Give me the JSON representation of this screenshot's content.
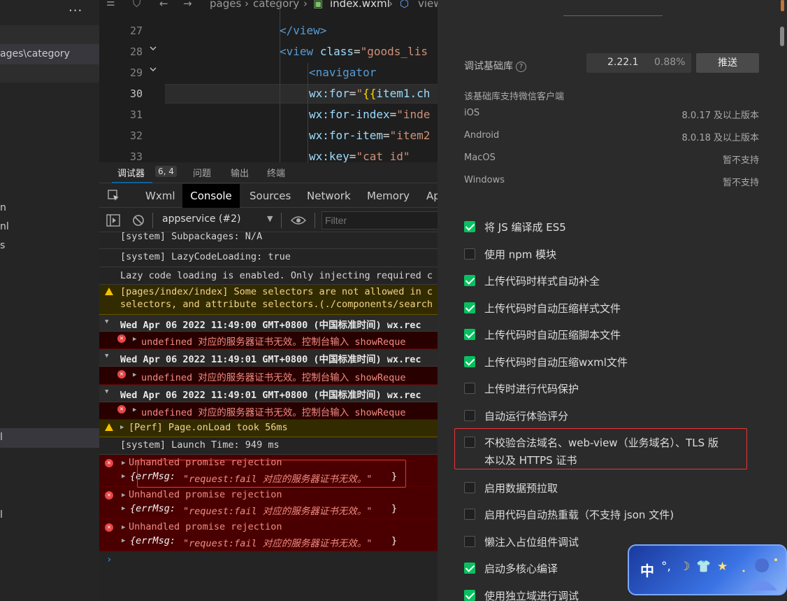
{
  "sidebar": {
    "menu": "...",
    "path_fragment": "ages\\category",
    "frag_n": "n",
    "frag_nl": "nl",
    "frag_s": "s",
    "frag_l": "l",
    "frag_l2": "l"
  },
  "breadcrumb": {
    "items": [
      "pages",
      "category",
      "index.wxml",
      "view"
    ]
  },
  "editor": {
    "lines": [
      {
        "num": "27",
        "html": "</view>"
      },
      {
        "num": "28",
        "html": "<view class=\"goods_lis"
      },
      {
        "num": "29",
        "html": "<navigator"
      },
      {
        "num": "30",
        "html": "wx:for=\"{{item1.ch"
      },
      {
        "num": "31",
        "html": "wx:for-index=\"inde"
      },
      {
        "num": "32",
        "html": "wx:for-item=\"item2"
      },
      {
        "num": "33",
        "html": "wx:key=\"cat_id\""
      }
    ]
  },
  "debug_tabs": {
    "debugger": "调试器",
    "position": "6, 4",
    "issues": "问题",
    "output": "输出",
    "terminal": "终端"
  },
  "devtools_tabs": [
    "Wxml",
    "Console",
    "Sources",
    "Network",
    "Memory",
    "Ap"
  ],
  "console_toolbar": {
    "context": "appservice (#2)",
    "filter_placeholder": "Filter"
  },
  "console": [
    {
      "type": "sys",
      "text": "[system] Subpackages: N/A"
    },
    {
      "type": "sys",
      "text": "[system] LazyCodeLoading: true"
    },
    {
      "type": "sys",
      "text": "Lazy code loading is enabled. Only injecting required c"
    },
    {
      "type": "warn",
      "text1": "[pages/index/index] Some selectors are not allowed in c",
      "text2": "selectors, and attribute selectors.(./components/search"
    },
    {
      "type": "grp",
      "text": "Wed Apr 06 2022 11:49:00 GMT+0800 (中国标准时间) wx.rec"
    },
    {
      "type": "err",
      "text": "undefined 对应的服务器证书无效。控制台输入 showReque"
    },
    {
      "type": "grp",
      "text": "Wed Apr 06 2022 11:49:01 GMT+0800 (中国标准时间) wx.rec"
    },
    {
      "type": "err",
      "text": "undefined 对应的服务器证书无效。控制台输入 showReque"
    },
    {
      "type": "grp",
      "text": "Wed Apr 06 2022 11:49:01 GMT+0800 (中国标准时间) wx.rec"
    },
    {
      "type": "err",
      "text": "undefined 对应的服务器证书无效。控制台输入 showReque"
    },
    {
      "type": "warn1",
      "text": "[Perf] Page.onLoad took 56ms"
    },
    {
      "type": "sys",
      "text": "[system] Launch Time: 949 ms"
    },
    {
      "type": "errbig",
      "text1": "Unhandled promise rejection",
      "key": "{errMsg: ",
      "val": "\"request:fail 对应的服务器证书无效。\"",
      "close": "}"
    },
    {
      "type": "errbig",
      "text1": "Unhandled promise rejection",
      "key": "{errMsg: ",
      "val": "\"request:fail 对应的服务器证书无效。\"",
      "close": "}"
    },
    {
      "type": "errbig",
      "text1": "Unhandled promise rejection",
      "key": "{errMsg: ",
      "val": "\"request:fail 对应的服务器证书无效。\"",
      "close": "}"
    }
  ],
  "console_prompt": "›",
  "settings": {
    "base_lib_label": "调试基础库",
    "help": "?",
    "version": "2.22.1",
    "percent": "0.88%",
    "push": "推送",
    "support_title": "该基础库支持微信客户端",
    "platforms": [
      {
        "name": "iOS",
        "value": "8.0.17 及以上版本"
      },
      {
        "name": "Android",
        "value": "8.0.18 及以上版本"
      },
      {
        "name": "MacOS",
        "value": "暂不支持"
      },
      {
        "name": "Windows",
        "value": "暂不支持"
      }
    ],
    "options": [
      {
        "label": "将 JS 编译成 ES5",
        "checked": true
      },
      {
        "label": "使用 npm 模块",
        "checked": false
      },
      {
        "label": "上传代码时样式自动补全",
        "checked": true
      },
      {
        "label": "上传代码时自动压缩样式文件",
        "checked": true
      },
      {
        "label": "上传代码时自动压缩脚本文件",
        "checked": true
      },
      {
        "label": "上传代码时自动压缩wxml文件",
        "checked": true
      },
      {
        "label": "上传时进行代码保护",
        "checked": false
      },
      {
        "label": "自动运行体验评分",
        "checked": false
      },
      {
        "label": "不校验合法域名、web-view（业务域名）、TLS 版",
        "label2": "本以及 HTTPS 证书",
        "checked": false
      },
      {
        "label": "启用数据预拉取",
        "checked": false
      },
      {
        "label": "启用代码自动热重载（不支持 json 文件)",
        "checked": false
      },
      {
        "label": "懒注入占位组件调试",
        "checked": false
      },
      {
        "label": "启动多核心编译",
        "checked": true
      },
      {
        "label": "使用独立域进行调试",
        "checked": true
      }
    ]
  },
  "widget": {
    "char": "中",
    "icons": [
      "°,",
      "☽",
      "👕",
      "★"
    ]
  }
}
